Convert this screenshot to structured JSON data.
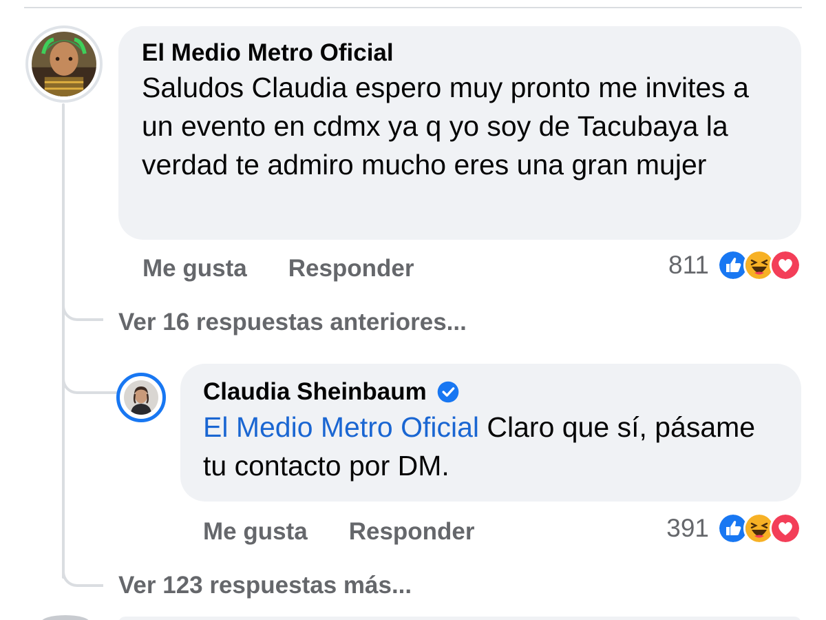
{
  "comment": {
    "author": "El Medio Metro Oficial",
    "text": "Saludos Claudia espero muy pronto me invites a un evento en cdmx ya q yo soy de Tacubaya la verdad te admiro mucho eres una gran mujer",
    "like_label": "Me gusta",
    "reply_label": "Responder",
    "reaction_count": "811",
    "reactions": [
      "like-icon",
      "haha-icon",
      "love-icon"
    ]
  },
  "view_previous": "Ver 16 respuestas anteriores...",
  "reply": {
    "author": "Claudia Sheinbaum",
    "verified": true,
    "mention": "El Medio Metro Oficial",
    "text": " Claro que sí, pásame tu contacto por DM.",
    "like_label": "Me gusta",
    "reply_label": "Responder",
    "reaction_count": "391",
    "reactions": [
      "like-icon",
      "haha-icon",
      "love-icon"
    ]
  },
  "view_more": "Ver 123 respuestas más...",
  "colors": {
    "bubble": "#f0f2f5",
    "secondary_text": "#65676b",
    "link": "#1a66d2",
    "verified": "#1877f2",
    "like": "#1877f2",
    "haha": "#f7b125",
    "love": "#f33e58"
  }
}
